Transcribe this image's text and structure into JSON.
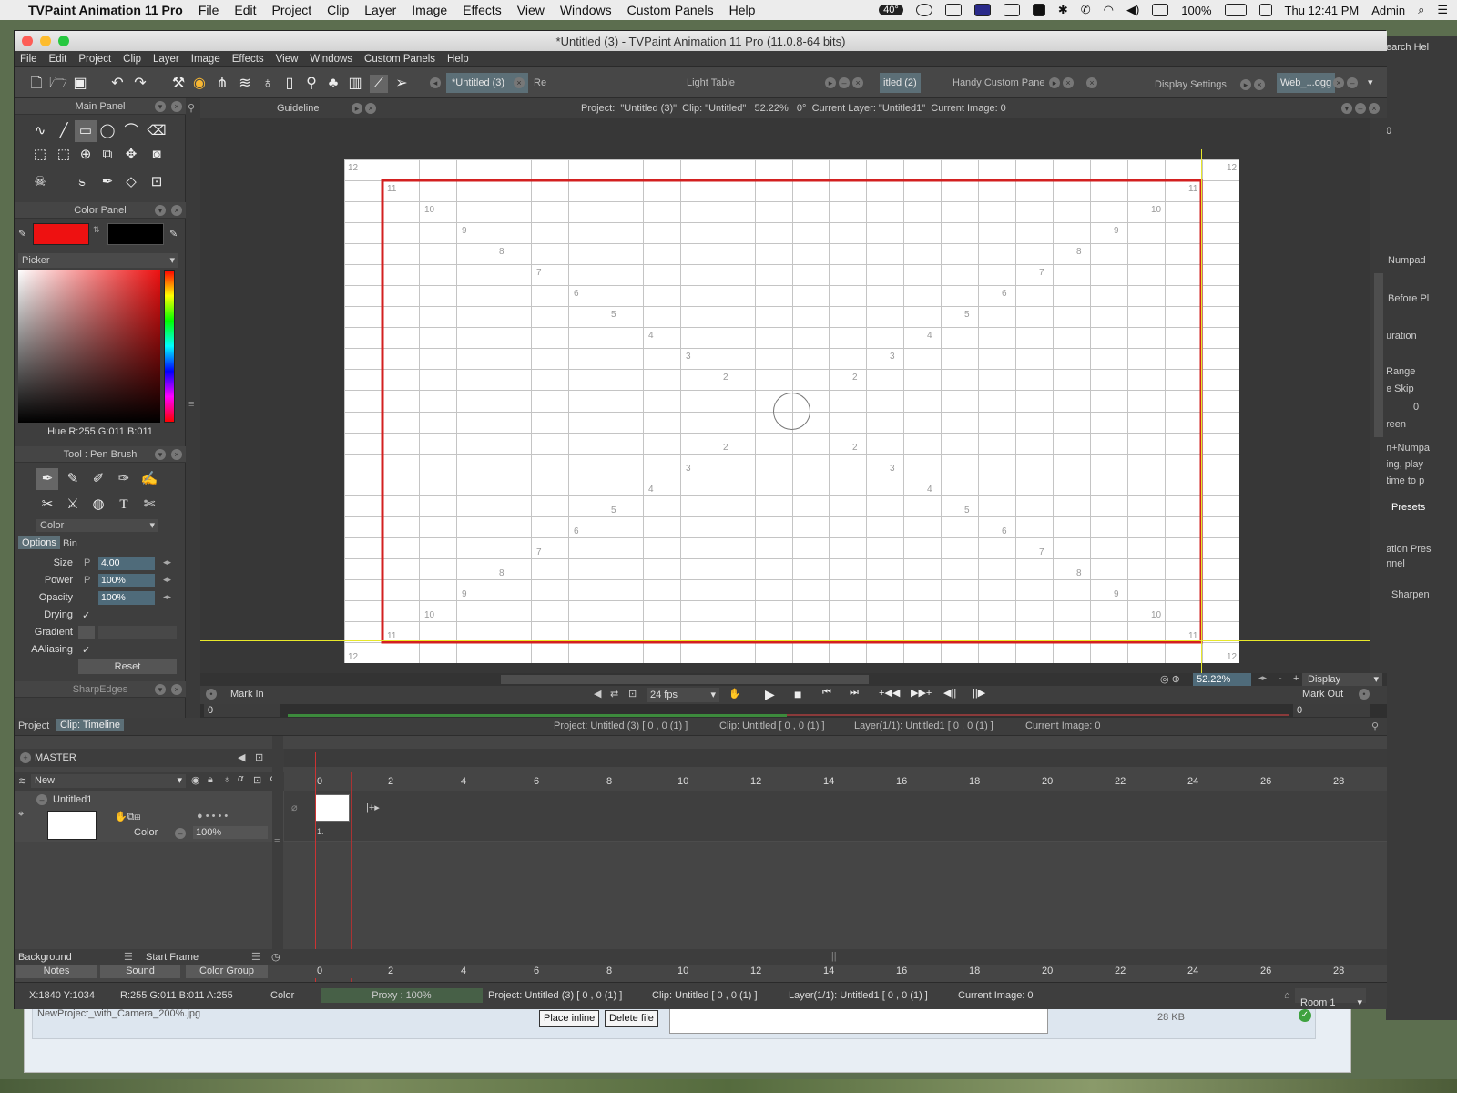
{
  "menubar": {
    "app_name": "TVPaint Animation 11 Pro",
    "items": [
      "File",
      "Edit",
      "Project",
      "Clip",
      "Layer",
      "Image",
      "Effects",
      "View",
      "Windows",
      "Custom Panels",
      "Help"
    ],
    "temperature": "40°",
    "battery": "100%",
    "clock": "Thu 12:41 PM",
    "user": "Admin"
  },
  "window": {
    "title": "*Untitled (3) - TVPaint Animation 11 Pro (11.0.8-64 bits)",
    "menu": [
      "File",
      "Edit",
      "Project",
      "Clip",
      "Layer",
      "Image",
      "Effects",
      "View",
      "Windows",
      "Custom Panels",
      "Help"
    ]
  },
  "toolbar_tabs": {
    "doc_tab": "*Untitled (3)",
    "doc_tab2": "Re",
    "light_table": "Light Table",
    "untitled2": "itled (2)",
    "handy": "Handy Custom Pane",
    "display_settings": "Display Settings",
    "web": "Web_...ogg"
  },
  "panels": {
    "main_panel": "Main Panel",
    "guideline": "Guideline",
    "color_panel": "Color Panel",
    "picker": "Picker",
    "color_readout": "Hue R:255 G:011 B:011",
    "tool_title": "Tool : Pen Brush",
    "color_mode": "Color",
    "tab_options": "Options",
    "tab_bin": "Bin",
    "size_label": "Size",
    "size_value": "4.00",
    "power_label": "Power",
    "power_value": "100%",
    "opacity_label": "Opacity",
    "opacity_value": "100%",
    "drying_label": "Drying",
    "gradient_label": "Gradient",
    "aaliasing_label": "AAliasing",
    "reset_label": "Reset",
    "sharpedges": "SharpEdges",
    "check": "✓",
    "p": "P"
  },
  "colors": {
    "primary": "#ee1111",
    "secondary": "#000000",
    "accent": "#4f6b7a"
  },
  "canvas": {
    "info": "Project:  \"Untitled (3)\"  Clip: \"Untitled\"   52.22%   0°  Current Layer: \"Untitled1\"  Current Image: 0",
    "zoom": "52.22%",
    "display_label": "Display",
    "mark_in": "Mark In",
    "mark_out": "Mark Out",
    "fps": "24 fps",
    "frame_in": "0",
    "frame_out": "0",
    "minus": "-",
    "plus": "+",
    "guide_numbers": [
      "12",
      "11",
      "10",
      "9",
      "8",
      "7",
      "6",
      "5",
      "4",
      "3",
      "2"
    ]
  },
  "timeline": {
    "tab_project": "Project",
    "tab_clip": "Clip: Timeline",
    "info_project": "Project: Untitled (3) [ 0 , 0  (1) ]",
    "info_clip": "Clip: Untitled [ 0 , 0  (1) ]",
    "info_layer": "Layer(1/1): Untitled1 [ 0 , 0  (1) ]",
    "info_image": "Current Image: 0",
    "master": "MASTER",
    "new_label": "New",
    "layer_name": "Untitled1",
    "layer_mode": "Color",
    "layer_opacity": "100%",
    "frame_label": "1.",
    "ruler": [
      "0",
      "2",
      "4",
      "6",
      "8",
      "10",
      "12",
      "14",
      "16",
      "18",
      "20",
      "22",
      "24",
      "26",
      "28"
    ],
    "btn_notes": "Notes",
    "btn_sound": "Sound",
    "btn_colorgroup": "Color Group",
    "background": "Background",
    "start_frame": "Start Frame"
  },
  "status": {
    "coords": "X:1840  Y:1034",
    "rgba": "R:255 G:011 B:011 A:255",
    "color": "Color",
    "proxy": "Proxy : 100%",
    "project": "Project: Untitled (3) [ 0 , 0  (1) ]",
    "clip": "Clip: Untitled [ 0 , 0  (1) ]",
    "layer": "Layer(1/1): Untitled1 [ 0 , 0  (1) ]",
    "image": "Current Image: 0",
    "room": "Room 1"
  },
  "background_window": {
    "filename": "NewProject_with_Camera_200%.jpg",
    "place_inline": "Place inline",
    "delete_file": "Delete file",
    "size": "28 KB"
  },
  "right_panel": [
    "0",
    "Numpad",
    "Before Pl",
    "uration",
    "Range",
    "e   Skip",
    "0",
    "reen",
    "n+Numpa",
    "ing, play",
    "time to p",
    "Presets",
    "ation Pres",
    "nnel",
    "Sharpen"
  ]
}
